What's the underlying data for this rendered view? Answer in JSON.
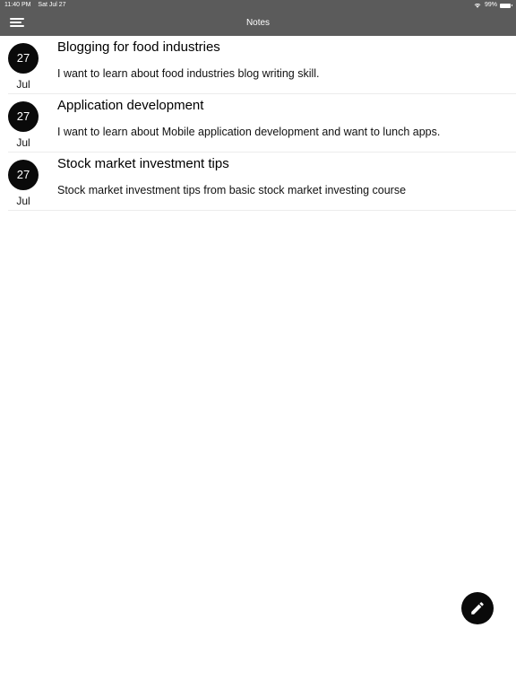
{
  "status_bar": {
    "time": "11:40 PM",
    "date": "Sat Jul 27",
    "battery": "99%",
    "wifi_icon": "wifi-icon",
    "battery_icon": "battery-icon"
  },
  "nav": {
    "title": "Notes",
    "menu_icon": "hamburger-menu-icon"
  },
  "notes": [
    {
      "day": "27",
      "month": "Jul",
      "title": "Blogging for food industries",
      "body": "I want to learn about food industries blog writing skill."
    },
    {
      "day": "27",
      "month": "Jul",
      "title": "Application development",
      "body": "I want to learn about Mobile application development and want to lunch apps."
    },
    {
      "day": "27",
      "month": "Jul",
      "title": "Stock market investment tips",
      "body": "Stock market investment tips from basic stock market investing course"
    }
  ],
  "fab": {
    "icon": "pencil-icon"
  },
  "colors": {
    "bar": "#5b5b5b",
    "accent": "#0a0a0a",
    "background": "#ffffff"
  }
}
